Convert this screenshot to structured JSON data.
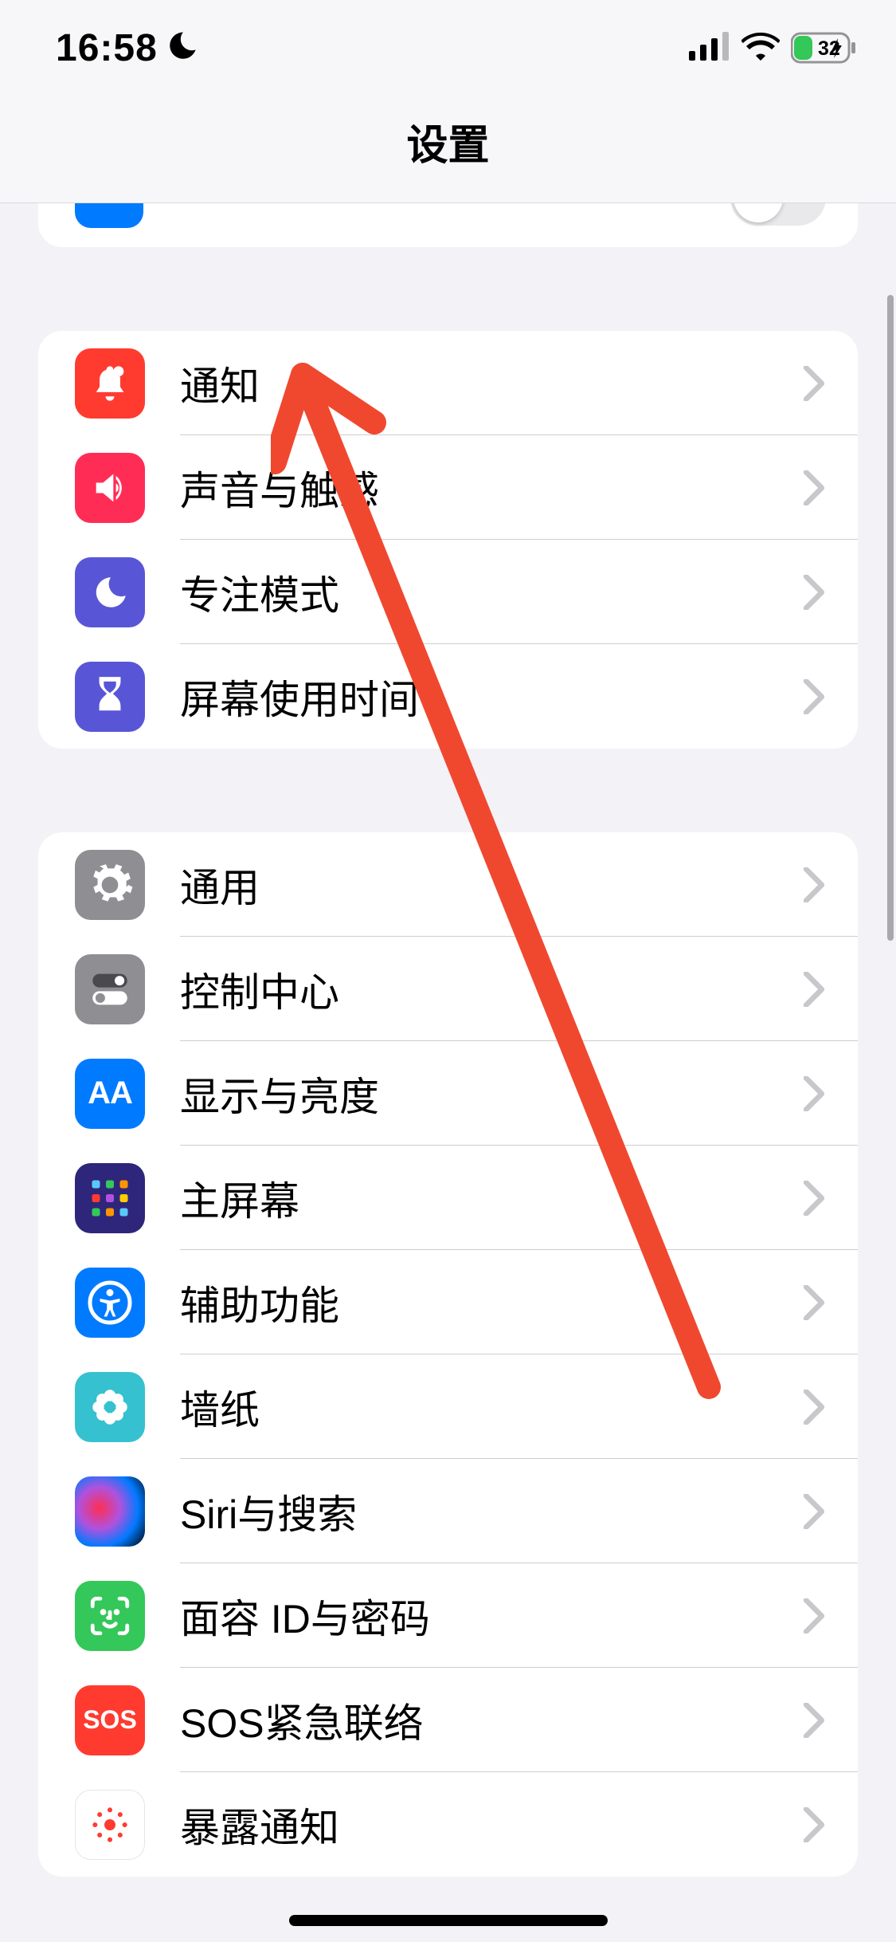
{
  "status": {
    "time": "16:58",
    "battery": "32"
  },
  "nav": {
    "title": "设置"
  },
  "group1": {
    "items": [
      {
        "label": "通知",
        "icon": "bell",
        "bg": "#ff3b30"
      },
      {
        "label": "声音与触感",
        "icon": "speaker",
        "bg": "#ff2d55"
      },
      {
        "label": "专注模式",
        "icon": "moon",
        "bg": "#5856d6"
      },
      {
        "label": "屏幕使用时间",
        "icon": "hourglass",
        "bg": "#5856d6"
      }
    ]
  },
  "group2": {
    "items": [
      {
        "label": "通用",
        "icon": "gear",
        "bg": "#8e8e93"
      },
      {
        "label": "控制中心",
        "icon": "switches",
        "bg": "#8e8e93"
      },
      {
        "label": "显示与亮度",
        "icon": "aa",
        "bg": "#007aff"
      },
      {
        "label": "主屏幕",
        "icon": "grid",
        "bg": "#3a3a9e"
      },
      {
        "label": "辅助功能",
        "icon": "accessibility",
        "bg": "#007aff"
      },
      {
        "label": "墙纸",
        "icon": "flower",
        "bg": "#35c1d0"
      },
      {
        "label": "Siri与搜索",
        "icon": "siri",
        "bg": "#000"
      },
      {
        "label": "面容 ID与密码",
        "icon": "faceid",
        "bg": "#34c759"
      },
      {
        "label": "SOS紧急联络",
        "icon": "sos",
        "bg": "#ff3b30"
      },
      {
        "label": "暴露通知",
        "icon": "exposure",
        "bg": "#fff"
      }
    ]
  }
}
